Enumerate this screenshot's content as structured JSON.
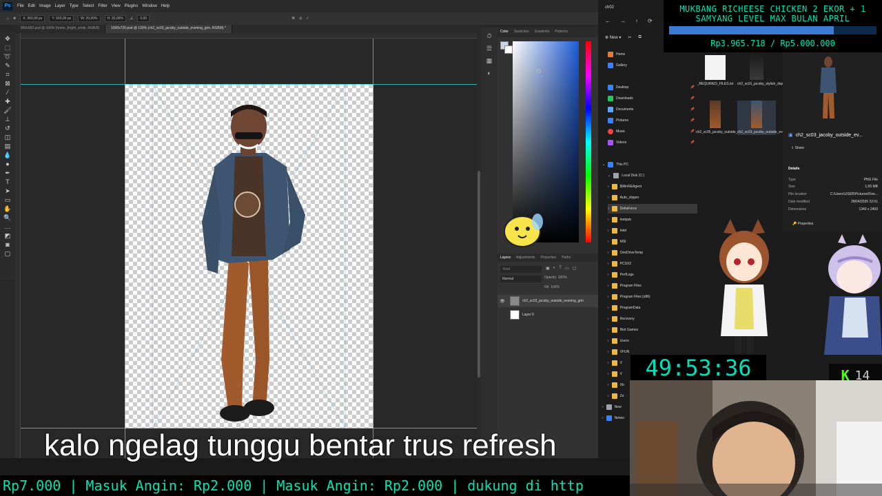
{
  "photoshop": {
    "menu": [
      "File",
      "Edit",
      "Image",
      "Layer",
      "Type",
      "Select",
      "Filter",
      "View",
      "Plugins",
      "Window",
      "Help"
    ],
    "options": {
      "x": "X: 360,00 px",
      "y": "Y: 500,00 px",
      "w": "W: 20,00%",
      "h": "H: 20,00%",
      "angle": "0,00"
    },
    "tabs": [
      "850x650.psd @ 100% (home_bright_smile, RGB/8)",
      "1000x720.psd @ 100% (ch2_sc03_jacoby_outside_evening_grin, RGB/8) *"
    ],
    "color_panel_tabs": [
      "Color",
      "Swatches",
      "Gradients",
      "Patterns"
    ],
    "layers_panel_tabs": [
      "Layers",
      "Adjustments",
      "Properties",
      "Paths"
    ],
    "layers_search": "Kind",
    "blend_mode": "Normal",
    "opacity": "Opacity: 100%",
    "fill": "Fill: 100%",
    "layers": [
      {
        "name": "ch2_sc03_jacoby_outside_evening_grin"
      },
      {
        "name": "Layer 0"
      }
    ]
  },
  "explorer": {
    "title": "ch02",
    "new_label": "New",
    "quick_access": [
      {
        "label": "Home",
        "color": "#e07b39"
      },
      {
        "label": "Gallery",
        "color": "#3b82f6"
      }
    ],
    "pinned": [
      {
        "label": "Desktop",
        "color": "#3b82f6"
      },
      {
        "label": "Downloads",
        "color": "#22c55e"
      },
      {
        "label": "Documents",
        "color": "#60a5fa"
      },
      {
        "label": "Pictures",
        "color": "#3b82f6"
      },
      {
        "label": "Music",
        "color": "#ef4444"
      },
      {
        "label": "Videos",
        "color": "#a855f7"
      }
    ],
    "this_pc": "This PC",
    "local_disk": "Local Disk (C:)",
    "folders": [
      "$WinREAgent",
      "Auto_clipper",
      "DeltaForce",
      "inetpub",
      "Intel",
      "MSI",
      "OneDriveTemp",
      "PCSX2",
      "PerfLogs",
      "Program Files",
      "Program Files (x86)",
      "ProgramData",
      "Recovery",
      "Riot Games",
      "Users",
      "VFUN",
      "V",
      "V",
      "Xb",
      "Ze"
    ],
    "network": [
      "New",
      "Netwo"
    ],
    "files": [
      {
        "name": "_REQUIRED_FILES.txt"
      },
      {
        "name": "ch2_sc01_jacoby_stylish_day_grin.png"
      },
      {
        "name": "ch2_sc05_jacoby_outside_evening_grin.png"
      },
      {
        "name": "ch2_sc03_jacoby_outside_evening_grin.png"
      }
    ],
    "details": {
      "filename": "ch2_sc03_jacoby_outside_ev...",
      "share": "Share",
      "heading": "Details",
      "rows": [
        {
          "k": "Type",
          "v": "PNG File"
        },
        {
          "k": "Size",
          "v": "1,65 MB"
        },
        {
          "k": "File location",
          "v": "C:\\Users\\USER\\Pictures\\Five..."
        },
        {
          "k": "Date modified",
          "v": "28/04/2026 22:01"
        },
        {
          "k": "Dimensions",
          "v": "1340 x 2400"
        }
      ],
      "properties": "Properties"
    }
  },
  "stream": {
    "goal_title": "MUKBANG RICHEESE CHICKEN 2 EKOR + 1 SAMYANG LEVEL MAX BULAN APRIL",
    "goal_amount": "Rp3.965.718 / Rp5.000.000",
    "goal_progress": 0.793,
    "timer": "49:53:36",
    "kick_count": "14",
    "subtitle": "kalo ngelag tunggu bentar trus refresh",
    "ticker": "Rp7.000 | Masuk Angin: Rp2.000 | Masuk Angin: Rp2.000 |  dukung di http"
  }
}
